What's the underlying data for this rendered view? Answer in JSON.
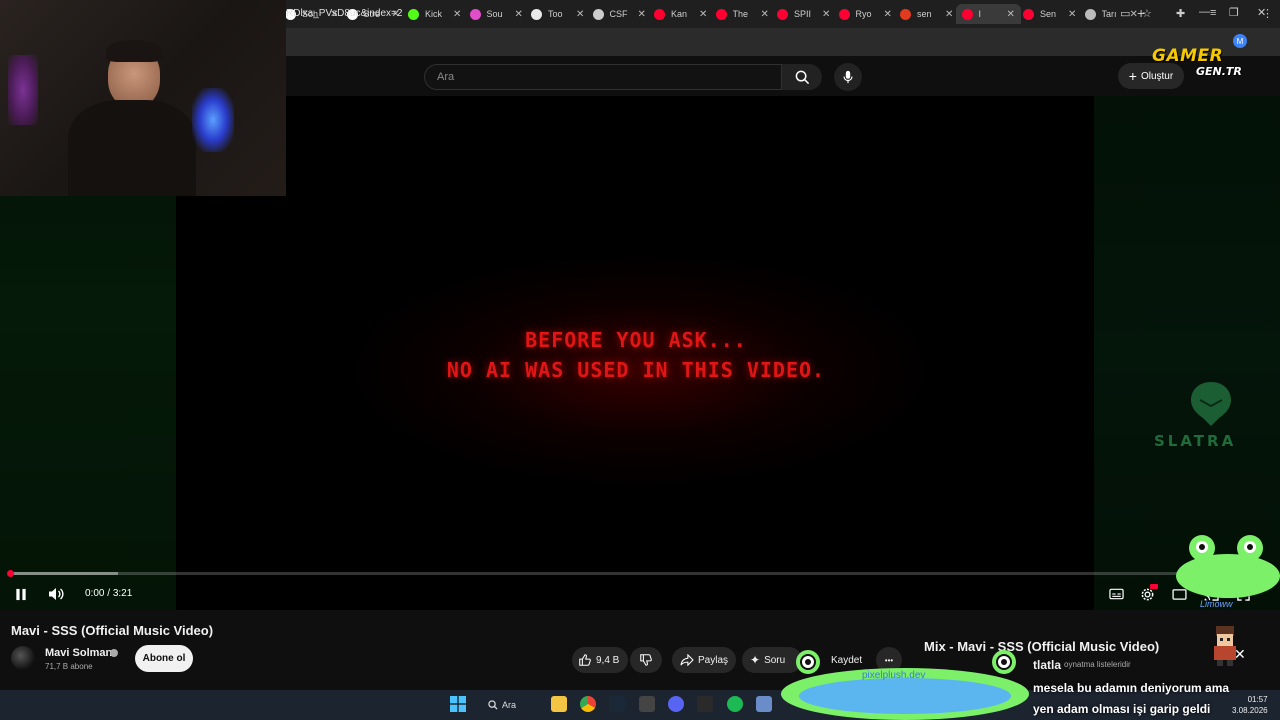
{
  "browser": {
    "tabs": [
      {
        "label": "Soh",
        "color": "#ffffff"
      },
      {
        "label": "Stre",
        "color": "#ffffff"
      },
      {
        "label": "Kick",
        "color": "#53fc18"
      },
      {
        "label": "Sou",
        "color": "#e14eca"
      },
      {
        "label": "Too",
        "color": "#e8e8e8"
      },
      {
        "label": "CSF",
        "color": "#cccccc"
      },
      {
        "label": "Kan",
        "color": "#ff0033"
      },
      {
        "label": "The",
        "color": "#ff0033"
      },
      {
        "label": "SPII",
        "color": "#ff0033"
      },
      {
        "label": "Ryo",
        "color": "#ff0033"
      },
      {
        "label": "sen",
        "color": "#e03a1f"
      },
      {
        "label": "I",
        "color": "#ff0033"
      },
      {
        "label": "Sen",
        "color": "#ff0033"
      },
      {
        "label": "Tarı",
        "color": "#bbbbbb"
      }
    ],
    "url": "RDlxa_PVsD8uc&index=2",
    "profile_initial": "M"
  },
  "youtube": {
    "search_placeholder": "Ara",
    "create_label": "Oluştur"
  },
  "video": {
    "overlay_line1": "BEFORE YOU ASK...",
    "overlay_line2": "NO AI WAS USED IN THIS VIDEO.",
    "time_current": "0:00",
    "time_separator": " / ",
    "time_total": "3:21",
    "progress_fraction": 0.0,
    "buffer_fraction": 0.086,
    "accent_color": "#ff0033",
    "title": "Mavi - SSS (Official Music Video)",
    "channel": "Mavi Solman",
    "subscribers": "71,7 B abone",
    "subscribe_label": "Abone ol",
    "likes": "9,4 B",
    "share_label": "Paylaş",
    "ask_label": "Soru",
    "save_label": "Kaydet",
    "more_label": "•••"
  },
  "mix": {
    "title": "Mix - Mavi - SSS (Official Music Video)",
    "subtitle_partial": "tlatla",
    "subtitle": "oynatma listeleridir"
  },
  "overlays": {
    "logo_top": "GAMER",
    "logo_bottom": "GEN.TR",
    "sponsor": "SLATRA",
    "pet_name": "Limoww",
    "frog_url": "pixelplush.dev",
    "chat_line1": "mesela bu adamın deniyorum ama",
    "chat_line2": "yen adam olması işi garip geldi"
  },
  "taskbar": {
    "search_label": "Ara",
    "time": "01:57",
    "date": "3.08.2026"
  }
}
